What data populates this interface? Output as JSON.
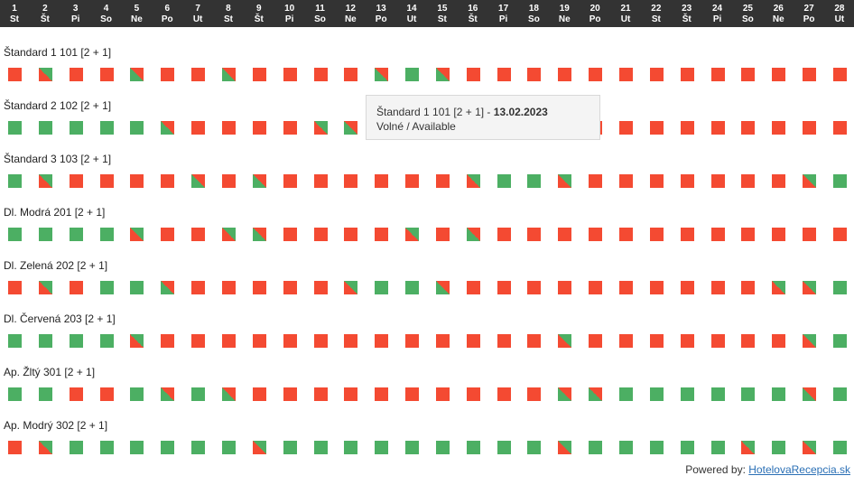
{
  "days": [
    {
      "num": "1",
      "wd": "St"
    },
    {
      "num": "2",
      "wd": "Št"
    },
    {
      "num": "3",
      "wd": "Pi"
    },
    {
      "num": "4",
      "wd": "So"
    },
    {
      "num": "5",
      "wd": "Ne"
    },
    {
      "num": "6",
      "wd": "Po"
    },
    {
      "num": "7",
      "wd": "Ut"
    },
    {
      "num": "8",
      "wd": "St"
    },
    {
      "num": "9",
      "wd": "Št"
    },
    {
      "num": "10",
      "wd": "Pi"
    },
    {
      "num": "11",
      "wd": "So"
    },
    {
      "num": "12",
      "wd": "Ne"
    },
    {
      "num": "13",
      "wd": "Po"
    },
    {
      "num": "14",
      "wd": "Ut"
    },
    {
      "num": "15",
      "wd": "St"
    },
    {
      "num": "16",
      "wd": "Št"
    },
    {
      "num": "17",
      "wd": "Pi"
    },
    {
      "num": "18",
      "wd": "So"
    },
    {
      "num": "19",
      "wd": "Ne"
    },
    {
      "num": "20",
      "wd": "Po"
    },
    {
      "num": "21",
      "wd": "Ut"
    },
    {
      "num": "22",
      "wd": "St"
    },
    {
      "num": "23",
      "wd": "Št"
    },
    {
      "num": "24",
      "wd": "Pi"
    },
    {
      "num": "25",
      "wd": "So"
    },
    {
      "num": "26",
      "wd": "Ne"
    },
    {
      "num": "27",
      "wd": "Po"
    },
    {
      "num": "28",
      "wd": "Ut"
    }
  ],
  "colors": {
    "free": "#4caf63",
    "occupied": "#f44a32",
    "header_bg": "#333333",
    "link": "#2a6fb5"
  },
  "legend_codes": {
    "f": "free",
    "o": "occupied",
    "i": "check-in (free→occupied)",
    "u": "check-out (occupied→free)"
  },
  "rooms": [
    {
      "label": "Štandard 1 101 [2 + 1]",
      "days": [
        "o",
        "i",
        "o",
        "o",
        "u",
        "o",
        "o",
        "u",
        "o",
        "o",
        "o",
        "o",
        "u",
        "f",
        "u",
        "o",
        "o",
        "o",
        "o",
        "o",
        "o",
        "o",
        "o",
        "o",
        "o",
        "o",
        "o",
        "o"
      ]
    },
    {
      "label": "Štandard 2 102 [2 + 1]",
      "days": [
        "f",
        "f",
        "f",
        "f",
        "f",
        "u",
        "o",
        "o",
        "o",
        "o",
        "i",
        "u",
        "o",
        "o",
        "o",
        "o",
        "o",
        "o",
        "o",
        "o",
        "o",
        "o",
        "o",
        "o",
        "o",
        "o",
        "o",
        "o"
      ]
    },
    {
      "label": "Štandard 3 103 [2 + 1]",
      "days": [
        "f",
        "i",
        "o",
        "o",
        "o",
        "o",
        "u",
        "o",
        "u",
        "o",
        "o",
        "o",
        "o",
        "o",
        "o",
        "i",
        "f",
        "f",
        "i",
        "o",
        "o",
        "o",
        "o",
        "o",
        "o",
        "o",
        "i",
        "f"
      ]
    },
    {
      "label": "Dl. Modrá 201 [2 + 1]",
      "days": [
        "f",
        "f",
        "f",
        "f",
        "i",
        "o",
        "o",
        "i",
        "u",
        "o",
        "o",
        "o",
        "o",
        "i",
        "o",
        "u",
        "o",
        "o",
        "o",
        "o",
        "o",
        "o",
        "o",
        "o",
        "o",
        "o",
        "o",
        "o"
      ]
    },
    {
      "label": "Dl. Zelená 202 [2 + 1]",
      "days": [
        "o",
        "i",
        "o",
        "f",
        "f",
        "u",
        "o",
        "o",
        "o",
        "o",
        "o",
        "i",
        "f",
        "f",
        "u",
        "o",
        "o",
        "o",
        "o",
        "o",
        "o",
        "o",
        "o",
        "o",
        "o",
        "i",
        "i",
        "f"
      ]
    },
    {
      "label": "Dl. Červená 203 [2 + 1]",
      "days": [
        "f",
        "f",
        "f",
        "f",
        "i",
        "o",
        "o",
        "o",
        "o",
        "o",
        "o",
        "o",
        "o",
        "o",
        "o",
        "o",
        "o",
        "o",
        "i",
        "o",
        "o",
        "o",
        "o",
        "o",
        "o",
        "o",
        "i",
        "f"
      ]
    },
    {
      "label": "Ap. Žltý 301 [2 + 1]",
      "days": [
        "f",
        "f",
        "o",
        "o",
        "f",
        "u",
        "f",
        "u",
        "o",
        "o",
        "o",
        "o",
        "o",
        "o",
        "o",
        "o",
        "o",
        "o",
        "u",
        "u",
        "f",
        "f",
        "f",
        "f",
        "f",
        "f",
        "u",
        "f"
      ]
    },
    {
      "label": "Ap. Modrý 302 [2 + 1]",
      "days": [
        "o",
        "i",
        "f",
        "f",
        "f",
        "f",
        "f",
        "f",
        "i",
        "f",
        "f",
        "f",
        "f",
        "f",
        "f",
        "f",
        "f",
        "f",
        "i",
        "f",
        "f",
        "f",
        "f",
        "f",
        "i",
        "f",
        "i",
        "f"
      ]
    }
  ],
  "tooltip": {
    "room": "Štandard 1 101 [2 + 1]",
    "separator": " - ",
    "date": "13.02.2023",
    "status": "Volné / Available"
  },
  "footer": {
    "prefix": "Powered by:",
    "link_text": "HotelovaRecepcia.sk"
  }
}
